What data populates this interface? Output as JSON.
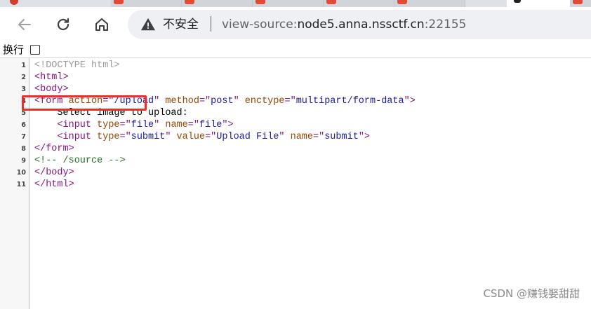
{
  "browser": {
    "security_label": "不安全",
    "url_scheme": "view-source:",
    "url_host": "node5.anna.nssctf.cn",
    "url_port": ":22155",
    "wrap_label": "换行",
    "icons": {
      "back": "back-arrow-icon",
      "reload": "reload-icon",
      "home": "home-icon",
      "warning": "warning-triangle-icon"
    }
  },
  "source": {
    "lines": [
      {
        "num": "1",
        "parts": [
          {
            "cls": "t-doctype",
            "text": "<!DOCTYPE html>"
          }
        ]
      },
      {
        "num": "2",
        "parts": [
          {
            "cls": "t-tag",
            "text": "<html>"
          }
        ]
      },
      {
        "num": "3",
        "parts": [
          {
            "cls": "t-tag",
            "text": "<body>"
          }
        ]
      },
      {
        "num": "4",
        "parts": [
          {
            "cls": "t-tag",
            "text": "<form "
          },
          {
            "cls": "t-attr",
            "text": "action"
          },
          {
            "cls": "t-tag",
            "text": "=\""
          },
          {
            "cls": "t-val",
            "text": "/upload"
          },
          {
            "cls": "t-tag",
            "text": "\" "
          },
          {
            "cls": "t-attr",
            "text": "method"
          },
          {
            "cls": "t-tag",
            "text": "=\""
          },
          {
            "cls": "t-val",
            "text": "post"
          },
          {
            "cls": "t-tag",
            "text": "\" "
          },
          {
            "cls": "t-attr",
            "text": "enctype"
          },
          {
            "cls": "t-tag",
            "text": "=\""
          },
          {
            "cls": "t-val",
            "text": "multipart/form-data"
          },
          {
            "cls": "t-tag",
            "text": "\">"
          }
        ]
      },
      {
        "num": "5",
        "parts": [
          {
            "cls": "t-text",
            "text": "    Select image to upload:"
          }
        ]
      },
      {
        "num": "6",
        "parts": [
          {
            "cls": "t-text",
            "text": "    "
          },
          {
            "cls": "t-tag",
            "text": "<input "
          },
          {
            "cls": "t-attr",
            "text": "type"
          },
          {
            "cls": "t-tag",
            "text": "=\""
          },
          {
            "cls": "t-val",
            "text": "file"
          },
          {
            "cls": "t-tag",
            "text": "\" "
          },
          {
            "cls": "t-attr",
            "text": "name"
          },
          {
            "cls": "t-tag",
            "text": "=\""
          },
          {
            "cls": "t-val",
            "text": "file"
          },
          {
            "cls": "t-tag",
            "text": "\">"
          }
        ]
      },
      {
        "num": "7",
        "parts": [
          {
            "cls": "t-text",
            "text": "    "
          },
          {
            "cls": "t-tag",
            "text": "<input "
          },
          {
            "cls": "t-attr",
            "text": "type"
          },
          {
            "cls": "t-tag",
            "text": "=\""
          },
          {
            "cls": "t-val",
            "text": "submit"
          },
          {
            "cls": "t-tag",
            "text": "\" "
          },
          {
            "cls": "t-attr",
            "text": "value"
          },
          {
            "cls": "t-tag",
            "text": "=\""
          },
          {
            "cls": "t-val",
            "text": "Upload File"
          },
          {
            "cls": "t-tag",
            "text": "\" "
          },
          {
            "cls": "t-attr",
            "text": "name"
          },
          {
            "cls": "t-tag",
            "text": "=\""
          },
          {
            "cls": "t-val",
            "text": "submit"
          },
          {
            "cls": "t-tag",
            "text": "\">"
          }
        ]
      },
      {
        "num": "8",
        "parts": [
          {
            "cls": "t-tag",
            "text": "</form>"
          }
        ]
      },
      {
        "num": "9",
        "parts": [
          {
            "cls": "t-comment",
            "text": "<!-- /source -->"
          }
        ]
      },
      {
        "num": "10",
        "parts": [
          {
            "cls": "t-tag",
            "text": "</body>"
          }
        ]
      },
      {
        "num": "11",
        "parts": [
          {
            "cls": "t-tag",
            "text": "</html>"
          }
        ]
      }
    ]
  },
  "annotation": {
    "highlight_color": "#f42a2a"
  },
  "watermark": "CSDN @赚钱娶甜甜"
}
